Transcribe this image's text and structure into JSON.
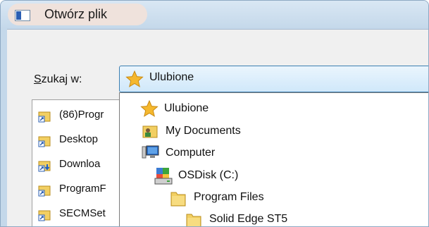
{
  "window": {
    "title": "Otwórz plik"
  },
  "lookin": {
    "label_underlined": "S",
    "label_rest": "zukaj w:",
    "selected": "Ulubione"
  },
  "sidebar": {
    "items": [
      {
        "label": "(86)Progr",
        "icon": "shortcut-folder-icon"
      },
      {
        "label": "Desktop",
        "icon": "shortcut-folder-icon"
      },
      {
        "label": "Downloa",
        "icon": "downloads-shortcut-icon"
      },
      {
        "label": "ProgramF",
        "icon": "shortcut-folder-icon"
      },
      {
        "label": "SECMSet",
        "icon": "shortcut-folder-icon"
      }
    ]
  },
  "dropdown": {
    "items": [
      {
        "label": "Ulubione",
        "icon": "star-icon"
      },
      {
        "label": "My Documents",
        "icon": "user-documents-icon"
      },
      {
        "label": "Computer",
        "icon": "computer-icon"
      },
      {
        "label": "OSDisk (C:)",
        "icon": "drive-icon"
      },
      {
        "label": "Program Files",
        "icon": "folder-icon"
      },
      {
        "label": "Solid Edge ST5",
        "icon": "folder-icon"
      }
    ]
  },
  "colors": {
    "title_bar": "#c4d8ea",
    "combo_highlight": "#d0e8fa",
    "combo_border": "#3c7fb1",
    "star": "#f5b82e",
    "folder": "#f2cf62"
  }
}
